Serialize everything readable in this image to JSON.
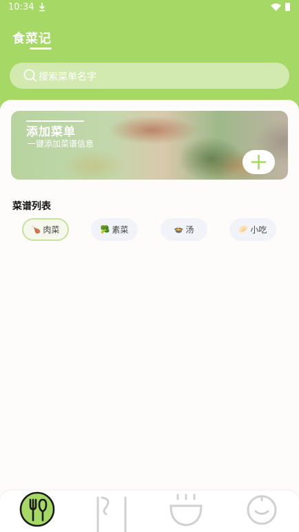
{
  "status_bar": {
    "time": "10:34"
  },
  "header": {
    "title": "食菜记"
  },
  "search": {
    "placeholder": "搜索菜单名字"
  },
  "banner": {
    "title": "添加菜单",
    "subtitle": "一键添加菜谱信息"
  },
  "recipe_list": {
    "title": "菜谱列表",
    "chips": [
      {
        "emoji": "🍗",
        "label": "肉菜",
        "active": true
      },
      {
        "emoji": "🥦",
        "label": "素菜",
        "active": false
      },
      {
        "emoji": "🍲",
        "label": "汤",
        "active": false
      },
      {
        "emoji": "🥟",
        "label": "小吃",
        "active": false
      }
    ]
  },
  "tabs": [
    {
      "icon": "fork-knife-icon",
      "active": true
    },
    {
      "icon": "menu-book-icon",
      "active": false
    },
    {
      "icon": "bowl-icon",
      "active": false
    },
    {
      "icon": "profile-icon",
      "active": false
    }
  ],
  "colors": {
    "primary": "#a5d864",
    "search_bg": "#d2eaaf",
    "chip_active_border": "#c7e09a",
    "icon_inactive": "#d0d0d0"
  }
}
